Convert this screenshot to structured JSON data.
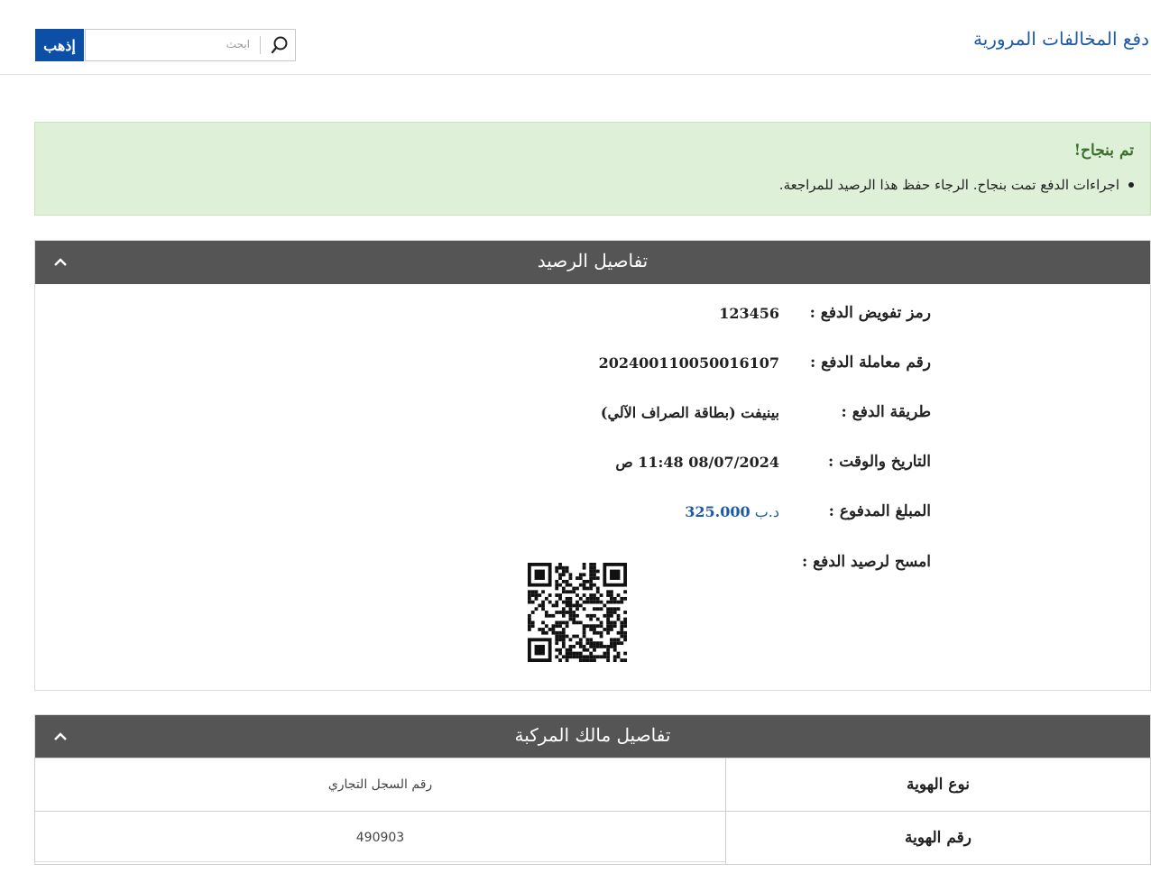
{
  "header": {
    "site_title": "دفع المخالفات المرورية",
    "go_button": "إذهب",
    "search_placeholder": "ابحث"
  },
  "alert": {
    "title": "تم بنجاح!",
    "message": "اجراءات الدفع تمت بنجاح. الرجاء حفظ هذا الرصيد للمراجعة."
  },
  "receipt": {
    "title": "تفاصيل الرصيد",
    "fields": [
      {
        "label": "رمز تفويض الدفع :",
        "value": "123456"
      },
      {
        "label": "رقم معاملة الدفع :",
        "value": "202400110050016107"
      },
      {
        "label": "طريقة الدفع :",
        "value": "بينيفت (بطاقة الصراف الآلي)"
      },
      {
        "label": "التاريخ والوقت :",
        "value": "08/07/2024 11:48 ص"
      },
      {
        "label": "المبلغ المدفوع :",
        "value_currency": "د.ب",
        "value_amount": "325.000"
      },
      {
        "label": "امسح لرصيد الدفع :",
        "value": ""
      }
    ]
  },
  "owner": {
    "title": "تفاصيل مالك المركبة",
    "rows": [
      {
        "label": "نوع الهوية",
        "value": "رقم السجل التجاري"
      },
      {
        "label": "رقم الهوية",
        "value": "490903"
      }
    ]
  },
  "colors": {
    "brand_blue": "#0b4fa6",
    "link_blue": "#1c5aa8",
    "success_bg": "#dff0d8",
    "panel_header": "#555555"
  },
  "icons": {
    "search": "search-icon",
    "collapse": "chevron-up-icon",
    "qr": "qr-code-icon"
  }
}
